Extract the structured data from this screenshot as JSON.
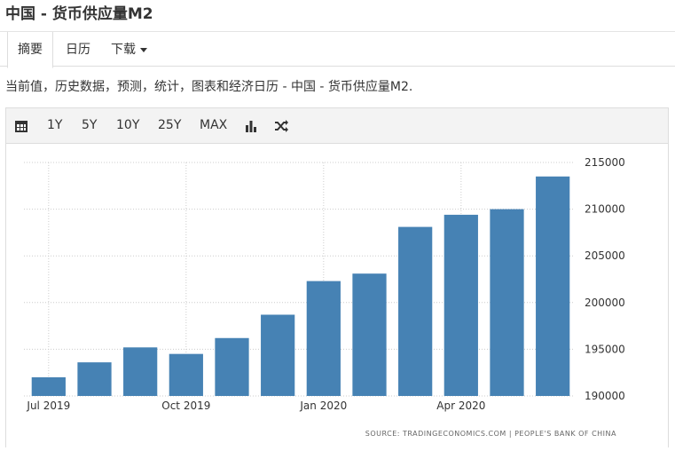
{
  "page": {
    "title": "中国 - 货币供应量M2"
  },
  "tabs": [
    {
      "label": "摘要",
      "active": true
    },
    {
      "label": "日历",
      "active": false
    },
    {
      "label": "下载",
      "active": false,
      "dropdown": true
    }
  ],
  "description": "当前值，历史数据，预测，统计，图表和经济日历 - 中国 - 货币供应量M2.",
  "toolbar": {
    "icons": [
      "calendar-icon",
      "bar-chart-icon",
      "shuffle-icon"
    ],
    "ranges": [
      "1Y",
      "5Y",
      "10Y",
      "25Y",
      "MAX"
    ]
  },
  "colors": {
    "bar": "#4682b4",
    "grid": "#cccccc",
    "toolbar_bg": "#f3f3f3"
  },
  "chart_data": {
    "type": "bar",
    "categories": [
      "2019-07",
      "2019-08",
      "2019-09",
      "2019-10",
      "2019-11",
      "2019-12",
      "2020-01",
      "2020-02",
      "2020-03",
      "2020-04",
      "2020-05",
      "2020-06"
    ],
    "values": [
      192000,
      193600,
      195200,
      194500,
      196200,
      198700,
      202300,
      203100,
      208100,
      209400,
      210000,
      213500
    ],
    "x_tick_labels": [
      "Jul 2019",
      "Oct 2019",
      "Jan 2020",
      "Apr 2020"
    ],
    "y_ticks": [
      190000,
      195000,
      200000,
      205000,
      210000,
      215000
    ],
    "ylim": [
      190000,
      215000
    ],
    "grid": true,
    "source": "SOURCE: TRADINGECONOMICS.COM  |  PEOPLE'S BANK OF CHINA"
  }
}
